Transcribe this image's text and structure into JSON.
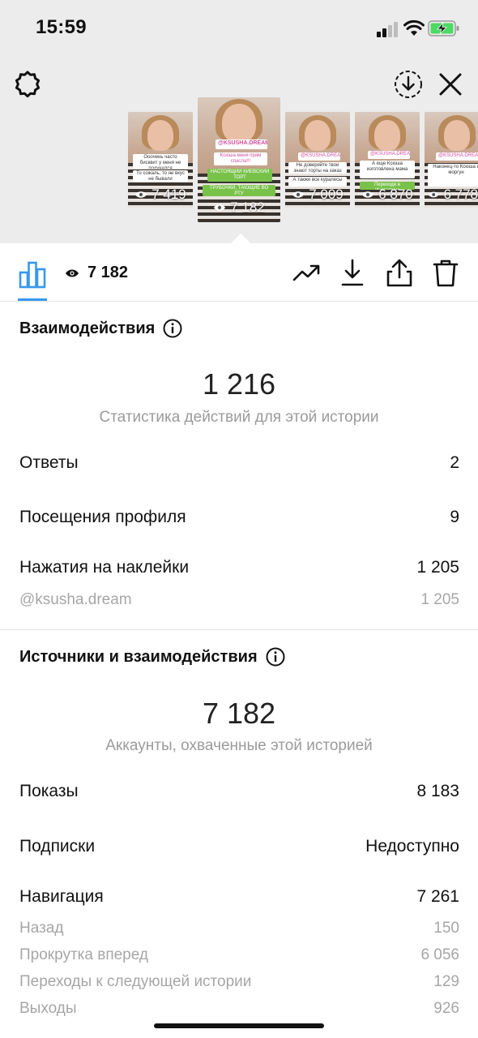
{
  "status_bar": {
    "time": "15:59"
  },
  "colors": {
    "accent": "#3897f0",
    "muted": "#9b9b9b",
    "battery": "#4cd964"
  },
  "stories": [
    {
      "views": "7 419",
      "stickers": [
        "Ооочень часто бисквит у меня не получался",
        "То сожаль, то не вкус не бывали"
      ]
    },
    {
      "views": "7 182",
      "stickers": [
        "@KSUSHA.DREAM",
        "Ксюша меня прям спасла!!!",
        "НАСТОЯЩИЙ КИЕВСКИЙ ТОРТ",
        "ТРУБОЧКИ, ТАЮЩИЕ ВО РТУ"
      ]
    },
    {
      "views": "7 009",
      "stickers": [
        "@KSUSHA.DREAM",
        "Не доверяйте твои знают торты на заказ",
        "А также все куралесы"
      ]
    },
    {
      "views": "6 870",
      "stickers": [
        "@KSUSHA.DREAM",
        "А еще Ксюша изготовлена мама",
        "Переходи в Инстаграм"
      ]
    },
    {
      "views": "6 778",
      "stickers": [
        "@KSUSHA.DREAM",
        "Наконец-то Ксюша в моргун"
      ]
    }
  ],
  "toolbar": {
    "views": "7 182"
  },
  "interactions": {
    "title": "Взаимодействия",
    "total": "1 216",
    "caption": "Статистика действий для этой истории",
    "rows": [
      {
        "label": "Ответы",
        "value": "2"
      },
      {
        "label": "Посещения профиля",
        "value": "9"
      },
      {
        "label": "Нажатия на наклейки",
        "value": "1 205"
      }
    ],
    "sub_rows": [
      {
        "label": "@ksusha.dream",
        "value": "1 205"
      }
    ]
  },
  "discovery": {
    "title": "Источники и взаимодействия",
    "total": "7 182",
    "caption": "Аккаунты, охваченные этой историей",
    "rows": [
      {
        "label": "Показы",
        "value": "8 183"
      },
      {
        "label": "Подписки",
        "value": "Недоступно"
      },
      {
        "label": "Навигация",
        "value": "7 261"
      }
    ],
    "sub_rows": [
      {
        "label": "Назад",
        "value": "150"
      },
      {
        "label": "Прокрутка вперед",
        "value": "6 056"
      },
      {
        "label": "Переходы к следующей истории",
        "value": "129"
      },
      {
        "label": "Выходы",
        "value": "926"
      }
    ]
  }
}
